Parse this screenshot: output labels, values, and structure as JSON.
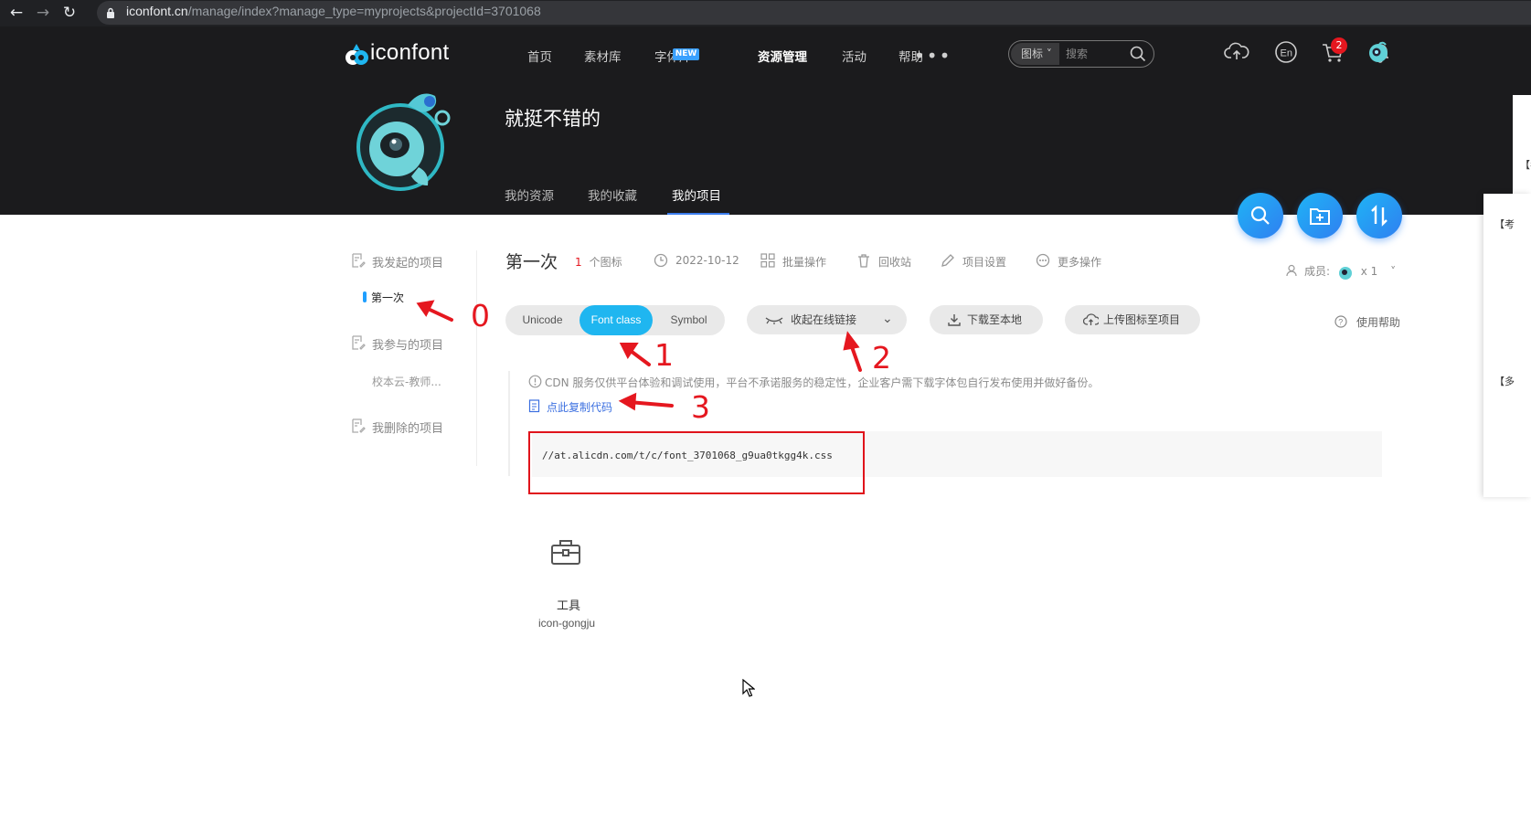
{
  "browser": {
    "url_host": "iconfont.cn",
    "url_path": "/manage/index?manage_type=myprojects&projectId=3701068",
    "back_icon": "arrow-left-icon",
    "forward_icon": "arrow-right-icon",
    "reload_icon": "reload-icon"
  },
  "header": {
    "logo_text": "iconfont",
    "nav": [
      {
        "label": "首页"
      },
      {
        "label": "素材库"
      },
      {
        "label": "字体库"
      },
      {
        "label": "资源管理"
      },
      {
        "label": "活动"
      },
      {
        "label": "帮助"
      }
    ],
    "new_badge": "NEW",
    "more_label": "•••",
    "search_category": "图标",
    "search_placeholder": "搜索",
    "notification_count": "2"
  },
  "profile": {
    "project_owner": "就挺不错的",
    "tabs": [
      {
        "label": "我的资源"
      },
      {
        "label": "我的收藏"
      },
      {
        "label": "我的项目"
      }
    ]
  },
  "sidebar": {
    "started_heading": "我发起的项目",
    "started_items": [
      {
        "label": "第一次"
      }
    ],
    "joined_heading": "我参与的项目",
    "joined_items": [
      {
        "label": "校本云-教师..."
      }
    ],
    "deleted_heading": "我删除的项目"
  },
  "project": {
    "title": "第一次",
    "icon_count": "1",
    "icon_count_unit": "个图标",
    "date": "2022-10-12",
    "actions": [
      {
        "label": "批量操作"
      },
      {
        "label": "回收站"
      },
      {
        "label": "项目设置"
      },
      {
        "label": "更多操作"
      }
    ],
    "members_label": "成员:",
    "members_count": "x 1"
  },
  "format_tabs": {
    "options": [
      {
        "label": "Unicode"
      },
      {
        "label": "Font class"
      },
      {
        "label": "Symbol"
      }
    ],
    "selected": "Font class"
  },
  "toolbar": {
    "collapse_link": "收起在线链接",
    "download": "下载至本地",
    "upload": "上传图标至项目",
    "help": "使用帮助"
  },
  "cdn": {
    "notice": "CDN 服务仅供平台体验和调试使用，平台不承诺服务的稳定性，企业客户需下载字体包自行发布使用并做好备份。",
    "copy_label": "点此复制代码",
    "css_url": "//at.alicdn.com/t/c/font_3701068_g9ua0tkgg4k.css"
  },
  "icons": [
    {
      "name": "工具",
      "code": "icon-gongju",
      "glyph": "toolbox-icon"
    }
  ],
  "overlay": {
    "side_text_1": "【考",
    "side_text_2": "【考",
    "side_text_3": "【多",
    "side_text_4": "【多"
  },
  "annotations": [
    {
      "label": "0"
    },
    {
      "label": "1"
    },
    {
      "label": "2"
    },
    {
      "label": "3"
    }
  ],
  "colors": {
    "accent": "#1fb6f0",
    "header_bg": "#1b1b1d",
    "annotation_red": "#e5171f",
    "link_blue": "#3b6fe0"
  }
}
